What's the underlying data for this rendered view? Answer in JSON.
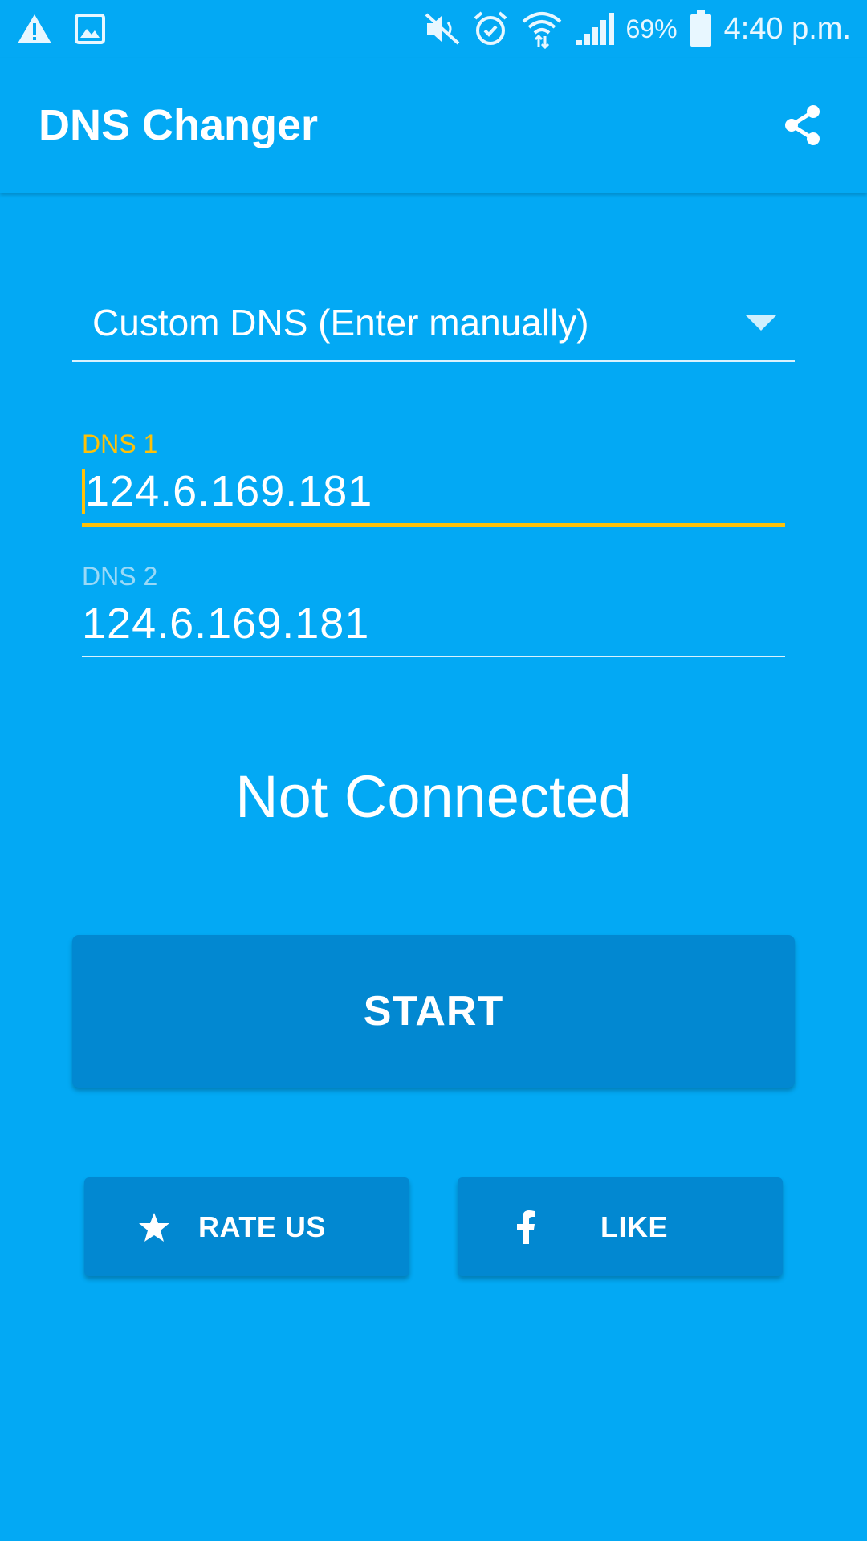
{
  "status_bar": {
    "battery_percent": "69%",
    "time": "4:40 p.m.",
    "icons": [
      "warning-icon",
      "image-icon",
      "mute-icon",
      "alarm-icon",
      "wifi-icon",
      "signal-icon",
      "battery-icon"
    ]
  },
  "app_bar": {
    "title": "DNS Changer",
    "share_icon": "share-icon"
  },
  "dns_selector": {
    "selected": "Custom DNS (Enter manually)"
  },
  "dns1": {
    "label": "DNS 1",
    "value": "124.6.169.181"
  },
  "dns2": {
    "label": "DNS 2",
    "value": "124.6.169.181"
  },
  "connection_status": "Not Connected",
  "buttons": {
    "start": "START",
    "rate": "RATE US",
    "like": "LIKE"
  },
  "colors": {
    "background": "#03A9F4",
    "button": "#0288D1",
    "accent": "#FFC107"
  }
}
